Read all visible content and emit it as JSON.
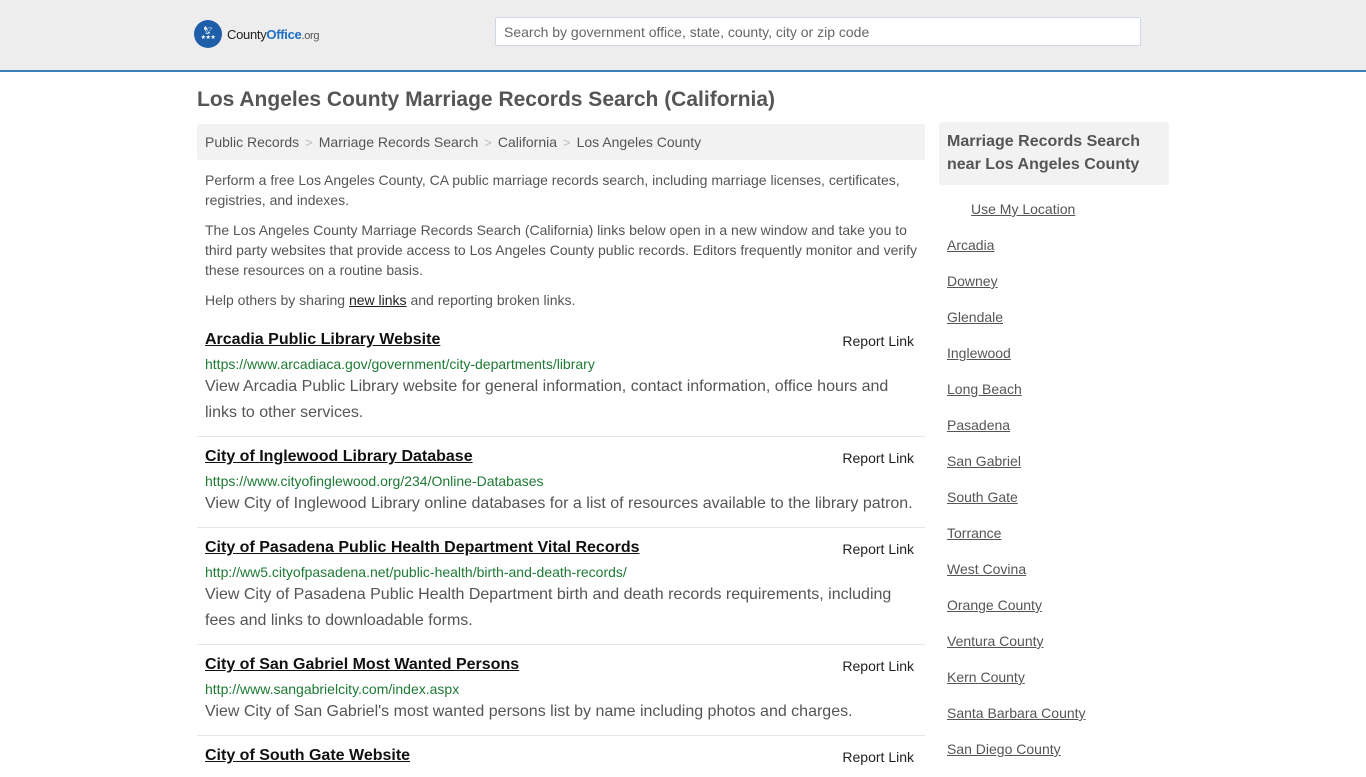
{
  "header": {
    "logo": {
      "brand_prefix": "County",
      "brand_main": "Office",
      "brand_suffix": ".org",
      "icon": "eagle-stars-icon"
    },
    "search": {
      "placeholder": "Search by government office, state, county, city or zip code",
      "value": ""
    }
  },
  "page": {
    "title": "Los Angeles County Marriage Records Search (California)",
    "breadcrumb": [
      {
        "label": "Public Records"
      },
      {
        "label": "Marriage Records Search"
      },
      {
        "label": "California"
      },
      {
        "label": "Los Angeles County"
      }
    ],
    "breadcrumb_separator": ">",
    "intro": {
      "p1": "Perform a free Los Angeles County, CA public marriage records search, including marriage licenses, certificates, registries, and indexes.",
      "p2": "The Los Angeles County Marriage Records Search (California) links below open in a new window and take you to third party websites that provide access to Los Angeles County public records. Editors frequently monitor and verify these resources on a routine basis.",
      "p3_before": "Help others by sharing ",
      "p3_link": "new links",
      "p3_after": " and reporting broken links."
    }
  },
  "results": [
    {
      "title": "Arcadia Public Library Website",
      "url": "https://www.arcadiaca.gov/government/city-departments/library",
      "description": "View Arcadia Public Library website for general information, contact information, office hours and links to other services.",
      "report_label": "Report Link"
    },
    {
      "title": "City of Inglewood Library Database",
      "url": "https://www.cityofinglewood.org/234/Online-Databases",
      "description": "View City of Inglewood Library online databases for a list of resources available to the library patron.",
      "report_label": "Report Link"
    },
    {
      "title": "City of Pasadena Public Health Department Vital Records",
      "url": "http://ww5.cityofpasadena.net/public-health/birth-and-death-records/",
      "description": "View City of Pasadena Public Health Department birth and death records requirements, including fees and links to downloadable forms.",
      "report_label": "Report Link"
    },
    {
      "title": "City of San Gabriel Most Wanted Persons",
      "url": "http://www.sangabrielcity.com/index.aspx",
      "description": "View City of San Gabriel's most wanted persons list by name including photos and charges.",
      "report_label": "Report Link"
    },
    {
      "title": "City of South Gate Website",
      "url": "",
      "description": "",
      "report_label": "Report Link"
    }
  ],
  "sidebar": {
    "heading": "Marriage Records Search near Los Angeles County",
    "use_location": "Use My Location",
    "links": [
      "Arcadia",
      "Downey",
      "Glendale",
      "Inglewood",
      "Long Beach",
      "Pasadena",
      "San Gabriel",
      "South Gate",
      "Torrance",
      "West Covina",
      "Orange County",
      "Ventura County",
      "Kern County",
      "Santa Barbara County",
      "San Diego County"
    ]
  },
  "colors": {
    "accent": "#3d7fb3",
    "brand_blue": "#1e5ea8",
    "url_green": "#1e7a34"
  }
}
